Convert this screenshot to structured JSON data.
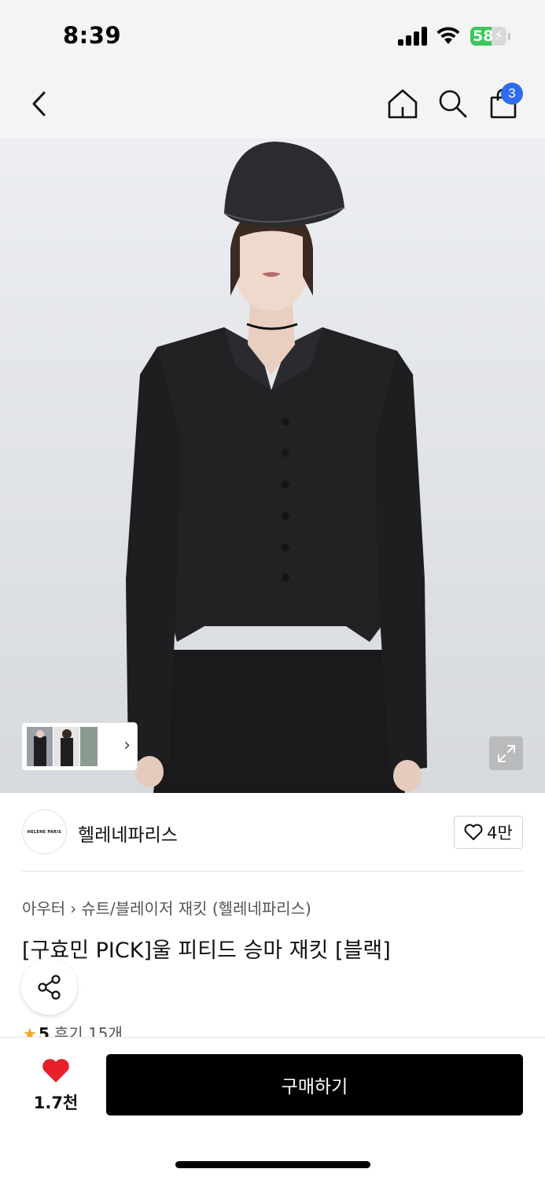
{
  "status_bar": {
    "time": "8:39",
    "battery": "58"
  },
  "header": {
    "cart_count": "3"
  },
  "gallery": {
    "icon": "expand-icon"
  },
  "brand": {
    "logo_text": "HELENE PARIS",
    "name": "헬레네파리스",
    "likes": "4만"
  },
  "breadcrumb": {
    "category": "아우터",
    "subcategory": "슈트/블레이저 재킷 (헬레네파리스)"
  },
  "product": {
    "title": "[구효민 PICK]울 피티드 승마 재킷 [블랙]"
  },
  "rating": {
    "score": "5",
    "review_label": "후기 15개"
  },
  "bottom_bar": {
    "wish_count": "1.7천",
    "buy_label": "구매하기"
  },
  "colors": {
    "accent": "#2f6bf0",
    "heart": "#e8202a",
    "battery": "#3ec65a",
    "star": "#f5a623"
  }
}
